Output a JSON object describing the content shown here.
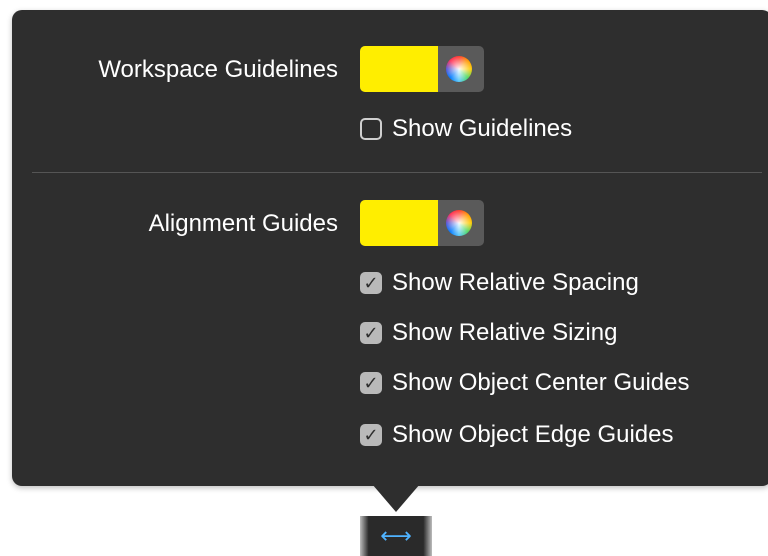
{
  "workspace_guidelines": {
    "label": "Workspace Guidelines",
    "color": "#ffee00",
    "show_guidelines": {
      "label": "Show Guidelines",
      "checked": false
    }
  },
  "alignment_guides": {
    "label": "Alignment Guides",
    "color": "#ffee00",
    "options": [
      {
        "label": "Show Relative Spacing",
        "checked": true
      },
      {
        "label": "Show Relative Sizing",
        "checked": true
      },
      {
        "label": "Show Object Center Guides",
        "checked": true
      },
      {
        "label": "Show Object Edge Guides",
        "checked": true
      }
    ]
  },
  "checkmark_glyph": "✓",
  "toolbar_button": {
    "icon": "horizontal-arrows-icon",
    "glyph": "⟷"
  },
  "colors": {
    "popover_background": "#2e2e2e",
    "text": "#ffffff",
    "accent_icon": "#4fb3ff"
  }
}
